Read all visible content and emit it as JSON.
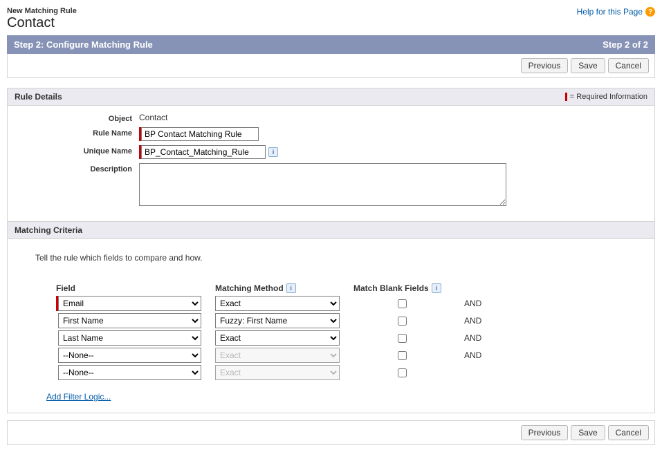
{
  "header": {
    "subtitle": "New Matching Rule",
    "title": "Contact",
    "help_text": "Help for this Page",
    "help_glyph": "?"
  },
  "step_bar": {
    "left": "Step 2: Configure Matching Rule",
    "right": "Step 2 of 2"
  },
  "buttons": {
    "previous": "Previous",
    "save": "Save",
    "cancel": "Cancel"
  },
  "rule_details": {
    "section_title": "Rule Details",
    "required_info": "= Required Information",
    "labels": {
      "object": "Object",
      "rule_name": "Rule Name",
      "unique_name": "Unique Name",
      "description": "Description"
    },
    "values": {
      "object": "Contact",
      "rule_name": "BP Contact Matching Rule",
      "unique_name": "BP_Contact_Matching_Rule",
      "description": ""
    }
  },
  "matching_criteria": {
    "section_title": "Matching Criteria",
    "description": "Tell the rule which fields to compare and how.",
    "columns": {
      "field": "Field",
      "method": "Matching Method",
      "blank": "Match Blank Fields"
    },
    "and_label": "AND",
    "rows": [
      {
        "field": "Email",
        "method": "Exact",
        "blank": false,
        "required": true,
        "method_disabled": false,
        "show_and": true
      },
      {
        "field": "First Name",
        "method": "Fuzzy: First Name",
        "blank": false,
        "required": false,
        "method_disabled": false,
        "show_and": true
      },
      {
        "field": "Last Name",
        "method": "Exact",
        "blank": false,
        "required": false,
        "method_disabled": false,
        "show_and": true
      },
      {
        "field": "--None--",
        "method": "Exact",
        "blank": false,
        "required": false,
        "method_disabled": true,
        "show_and": true
      },
      {
        "field": "--None--",
        "method": "Exact",
        "blank": false,
        "required": false,
        "method_disabled": true,
        "show_and": false
      }
    ],
    "filter_link": "Add Filter Logic..."
  },
  "info_glyph": "i"
}
